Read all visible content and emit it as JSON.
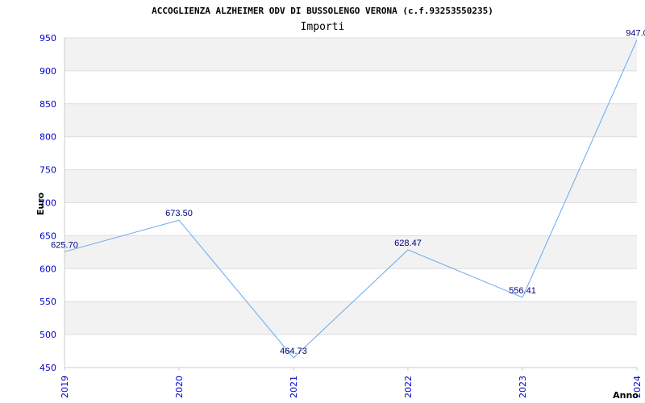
{
  "chart_data": {
    "type": "line",
    "title": "ACCOGLIENZA ALZHEIMER ODV DI BUSSOLENGO VERONA (c.f.93253550235)",
    "subtitle": "Importi",
    "xlabel": "Anno",
    "ylabel": "Euro",
    "ylim": [
      450,
      950
    ],
    "yticks": [
      450,
      500,
      550,
      600,
      650,
      700,
      750,
      800,
      850,
      900,
      950
    ],
    "x": [
      "2019",
      "2020",
      "2021",
      "2022",
      "2023",
      "2024"
    ],
    "series": [
      {
        "values": [
          625.7,
          673.5,
          464.73,
          628.47,
          556.41,
          947.0
        ],
        "labels": [
          "625.70",
          "673.50",
          "464.73",
          "628.47",
          "556.41",
          "947.0"
        ]
      }
    ],
    "grid": true,
    "band_colors": [
      "#f2f2f2",
      "#ffffff"
    ],
    "line_color": "#66aaee",
    "tick_color": "#0000cc",
    "label_color": "#000080"
  }
}
